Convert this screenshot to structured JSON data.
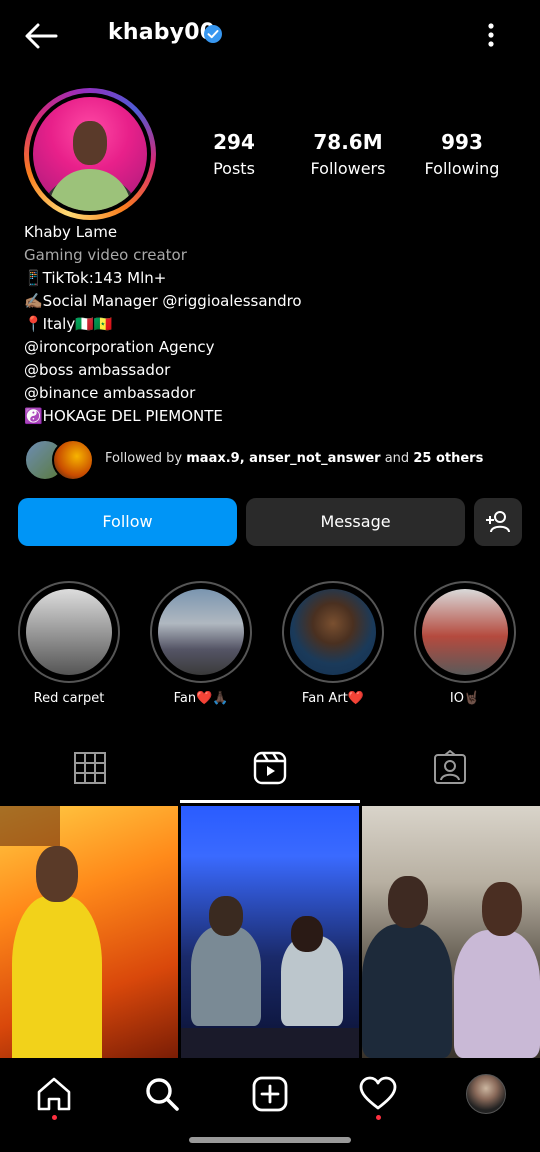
{
  "header": {
    "username": "khaby00"
  },
  "profile": {
    "stats": [
      {
        "value": "294",
        "label": "Posts"
      },
      {
        "value": "78.6M",
        "label": "Followers"
      },
      {
        "value": "993",
        "label": "Following"
      }
    ],
    "name": "Khaby Lame",
    "category": "Gaming video creator",
    "bio_lines": [
      "📱TikTok:143 Mln+",
      "✍🏽Social Manager @riggioalessandro",
      "📍Italy🇮🇹🇸🇳",
      "@ironcorporation Agency",
      "@boss ambassador",
      "@binance ambassador",
      "☯️HOKAGE DEL PIEMONTE"
    ],
    "followed_by": {
      "prefix": "Followed by",
      "names": "maax.9, anser_not_answer",
      "conj": "and",
      "others": "25 others"
    }
  },
  "actions": {
    "follow_label": "Follow",
    "message_label": "Message"
  },
  "highlights": [
    {
      "label": "Red carpet"
    },
    {
      "label": "Fan❤️🙏🏿"
    },
    {
      "label": "Fan Art❤️"
    },
    {
      "label": "IO🤘🏿"
    }
  ],
  "tabs": {
    "active": "reels"
  },
  "colors": {
    "accent": "#0095f6",
    "background": "#000000",
    "notification": "#ff3040"
  }
}
